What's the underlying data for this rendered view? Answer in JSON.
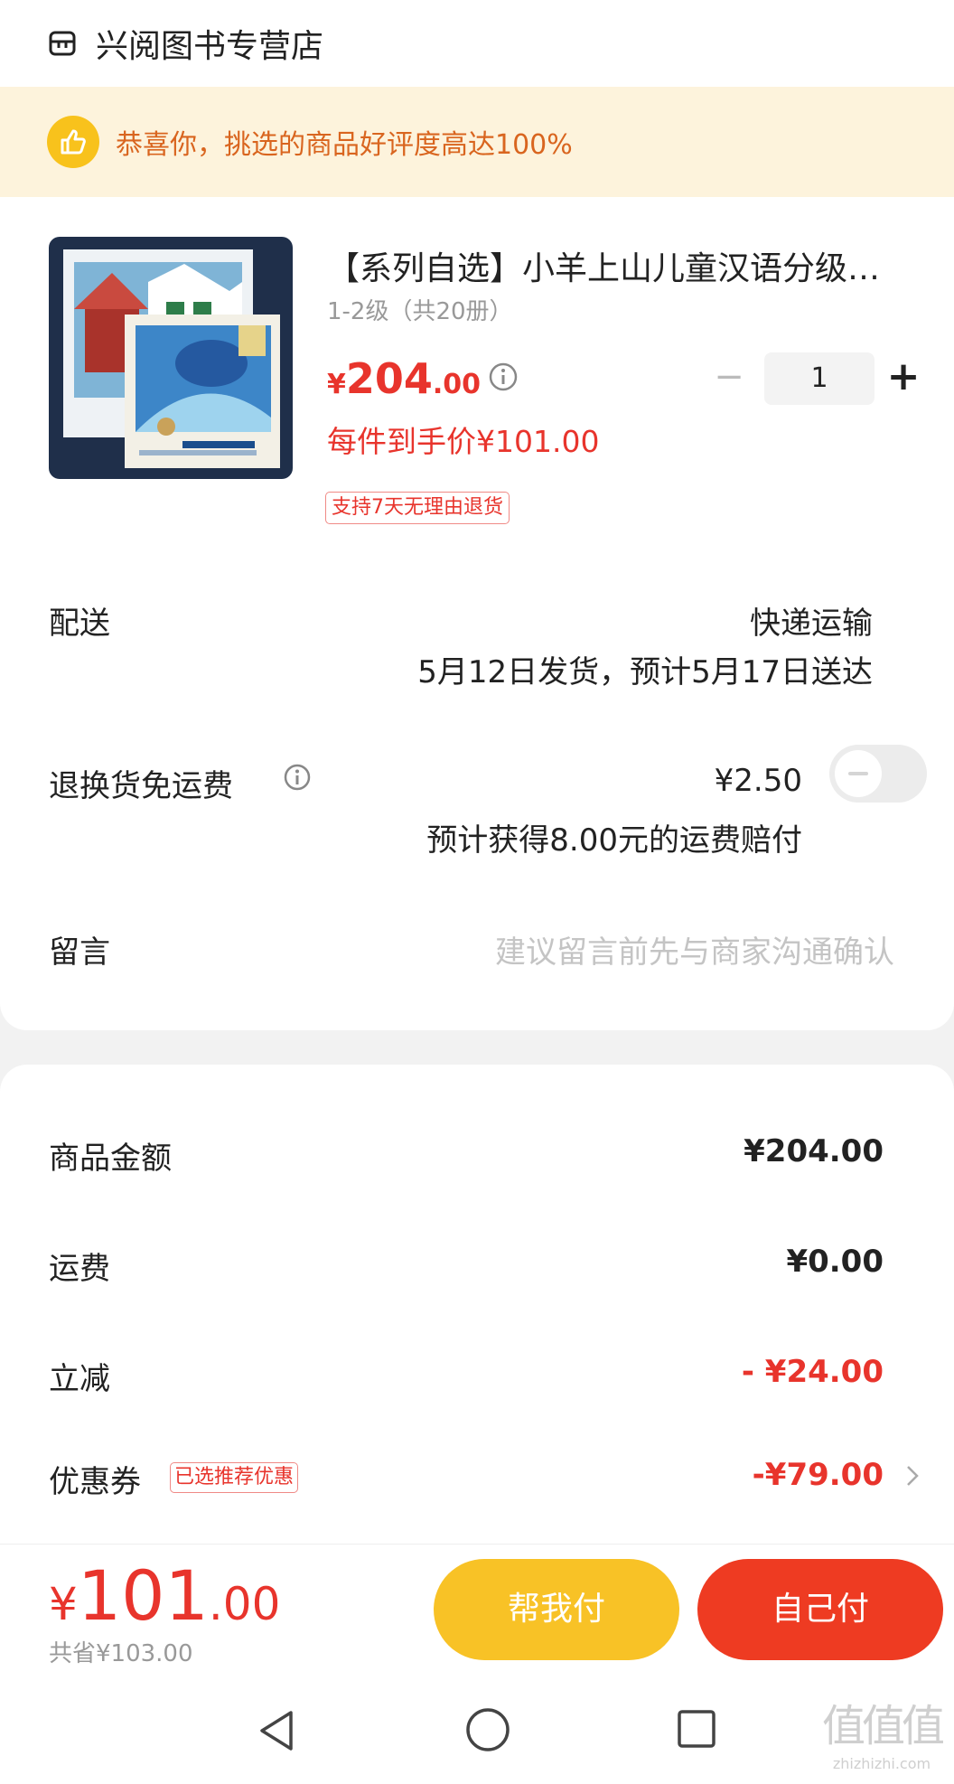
{
  "store": {
    "name": "兴阅图书专营店",
    "icon": "store-icon"
  },
  "banner": {
    "text": "恭喜你，挑选的商品好评度高达100%",
    "icon": "thumbs-up-icon"
  },
  "product": {
    "title": "【系列自选】小羊上山儿童汉语分级…",
    "spec": "1-2级（共20册）",
    "price_symbol": "¥",
    "price_int": "204",
    "price_dec": ".00",
    "quantity": "1",
    "minus_label": "−",
    "plus_label": "+",
    "deal_price": "每件到手价¥101.00",
    "return_tag": "支持7天无理由退货"
  },
  "delivery": {
    "label": "配送",
    "method": "快递运输",
    "date": "5月12日发货，预计5月17日送达"
  },
  "return_shipping": {
    "label": "退换货免运费",
    "fee": "¥2.50",
    "compensation": "预计获得8.00元的运费赔付",
    "enabled": false
  },
  "message": {
    "label": "留言",
    "placeholder": "建议留言前先与商家沟通确认"
  },
  "summary": {
    "goods_label": "商品金额",
    "goods_value": "¥204.00",
    "shipping_label": "运费",
    "shipping_value": "¥0.00",
    "discount_label": "立减",
    "discount_value": "- ¥24.00",
    "coupon_label": "优惠券",
    "coupon_tag": "已选推荐优惠",
    "coupon_value": "-¥79.00"
  },
  "bottom": {
    "total_symbol": "¥",
    "total_int": "101",
    "total_dec": ".00",
    "saved": "共省¥103.00",
    "help_pay_label": "帮我付",
    "self_pay_label": "自己付"
  },
  "watermark": {
    "glyphs": "值值值",
    "url": "zhizhizhi.com"
  },
  "colors": {
    "accent_red": "#e8342c",
    "help_yellow": "#f8c226",
    "pay_red": "#ee3b22",
    "banner_bg": "#fdf3dc"
  }
}
